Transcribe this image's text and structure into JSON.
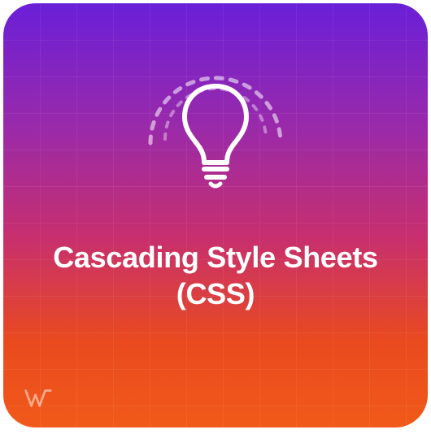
{
  "card": {
    "title_line1": "Cascading Style Sheets",
    "title_line2": "(CSS)",
    "icon": "lightbulb-icon",
    "logo": "w-logo"
  },
  "colors": {
    "gradient_start": "#6a1fd8",
    "gradient_end": "#f15a1a",
    "text": "#ffffff"
  }
}
